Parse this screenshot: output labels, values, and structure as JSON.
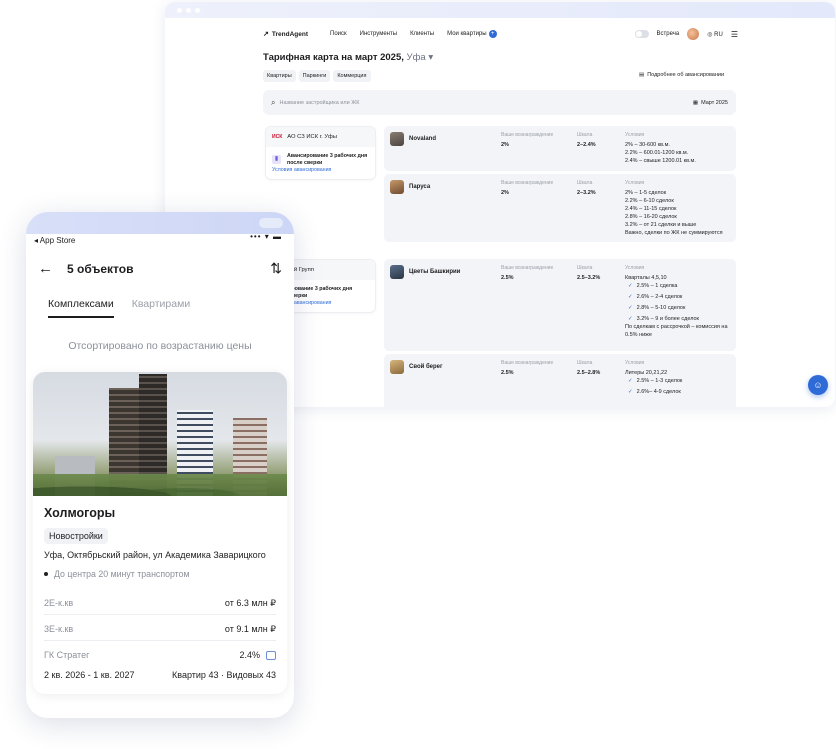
{
  "nav": {
    "brand": "TrendAgent",
    "links": [
      "Поиск",
      "Инструменты",
      "Клиенты",
      "Мои квартиры"
    ],
    "plus": "+",
    "meeting": "Встреча",
    "lang": "RU"
  },
  "page": {
    "title": "Тарифная карта на март 2025,",
    "city": "Уфа",
    "tabs": [
      "Квартиры",
      "Паркинги",
      "Коммерция"
    ],
    "info_link": "Подробнее об авансировании",
    "search_placeholder": "Название застройщика или ЖК",
    "date": "Март 2025"
  },
  "developers": [
    {
      "name": "АО СЗ ИСК г. Уфы",
      "logo": "ИСК",
      "advance": "Авансирование 3 рабочих дня после сверки",
      "link": "Условия авансирования"
    },
    {
      "name": "Архстрой Групп",
      "advance": "Авансирование 3 рабочих дня после сверки",
      "link": "Условия авансирования"
    }
  ],
  "columns": {
    "reward": "Ваше вознаграждение",
    "scale": "Шкала",
    "conditions": "Условия"
  },
  "complexes": [
    {
      "name": "Novaland",
      "reward": "2%",
      "scale": "2–2.4%",
      "conditions": [
        "2% – 30-600 кв.м.",
        "2.2% – 600.01-1200 кв.м.",
        "2.4% – свыше 1200.01 кв.м."
      ]
    },
    {
      "name": "Паруса",
      "reward": "2%",
      "scale": "2–3.2%",
      "conditions": [
        "2% – 1-5 сделок",
        "2.2% – 6-10 сделок",
        "2.4% – 11-15 сделок",
        "2.8% – 16-20 сделок",
        "3.2% – от 21 сделки и выше",
        "Важно, сделки по ЖК не суммируются"
      ]
    },
    {
      "name": "Цветы Башкирии",
      "reward": "2.5%",
      "scale": "2.5–3.2%",
      "heading": "Кварталы 4,5,10",
      "checks": [
        "2.5% – 1 сделка",
        "2.6% – 2-4 сделок",
        "2.8% – 5-10 сделок",
        "3.2% – 9 и более сделок"
      ],
      "note": "По сделкам с рассрочкой – комиссия на 0.5% ниже"
    },
    {
      "name": "Свой берег",
      "reward": "2.5%",
      "scale": "2.5–2.8%",
      "heading": "Литеры 20,21,22",
      "checks": [
        "2.5% – 1-3 сделок",
        "2.6%– 4-9 сделок"
      ]
    }
  ],
  "phone": {
    "app_store": "◂ App Store",
    "status_right": "••• ▾ ▬",
    "title": "5 объектов",
    "tabs": [
      "Комплексами",
      "Квартирами"
    ],
    "sorted": "Отсортировано по возрастанию цены",
    "card": {
      "name": "Холмогоры",
      "badge": "Новостройки",
      "address": "Уфа, Октябрьский район, ул Академика Заварицкого",
      "metro": "До центра 20 минут транспортом",
      "rows": [
        {
          "label": "2Е-к.кв",
          "value": "от 6.3 млн ₽"
        },
        {
          "label": "3Е-к.кв",
          "value": "от 9.1 млн ₽"
        },
        {
          "label": "ГК Стратег",
          "value": "2.4%"
        }
      ],
      "deadline": "2 кв. 2026 - 1 кв. 2027",
      "building": "Квартир 43 · Видовых 43"
    }
  },
  "colors": {
    "accent": "#2f6bd6",
    "panel": "#f3f4f7"
  }
}
